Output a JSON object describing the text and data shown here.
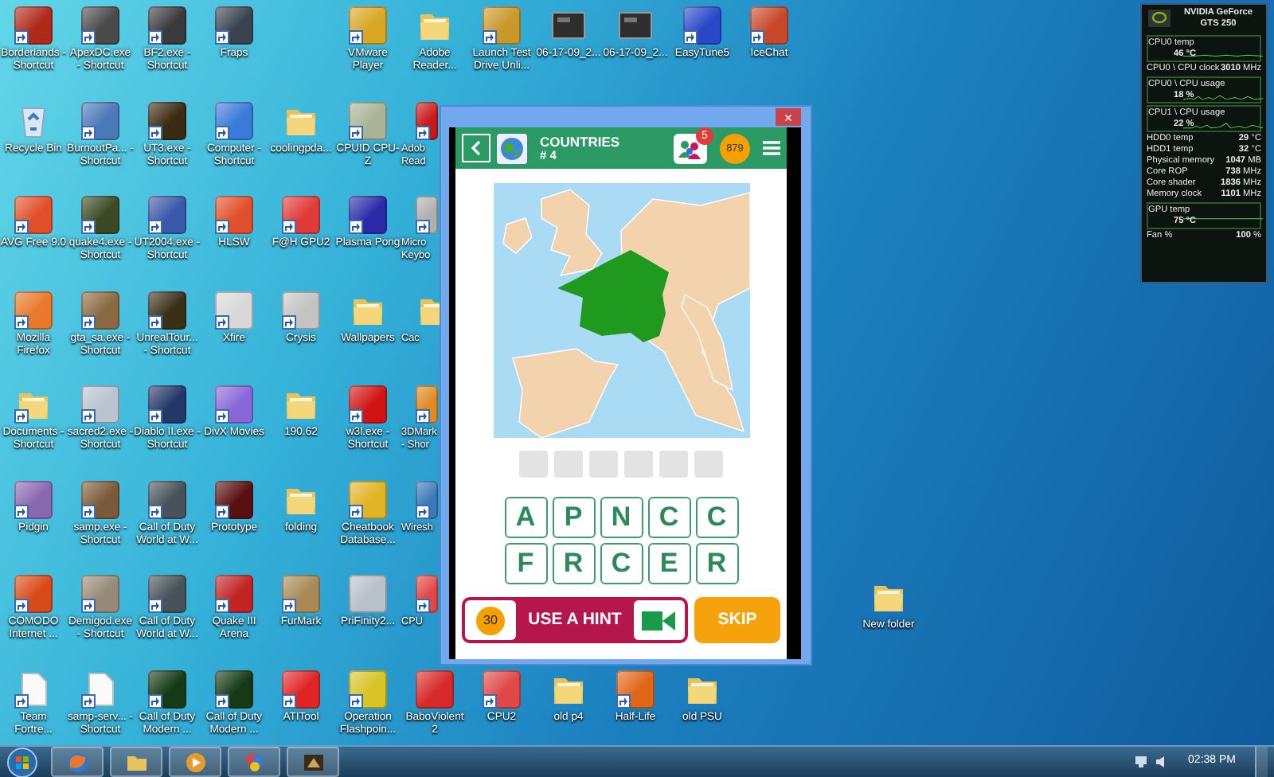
{
  "desktop": {
    "columns": [
      {
        "icons": [
          {
            "label": "Borderlands - Shortcut",
            "kind": "app",
            "color": "#b02a1a",
            "shortcut": true
          },
          {
            "label": "Recycle Bin",
            "kind": "bin",
            "shortcut": false
          },
          {
            "label": "AVG Free 9.0",
            "kind": "app",
            "color": "#e0502a",
            "shortcut": true
          },
          {
            "label": "Mozilla Firefox",
            "kind": "app",
            "color": "#e8782a",
            "shortcut": true
          },
          {
            "label": "Documents - Shortcut",
            "kind": "folder",
            "shortcut": true
          },
          {
            "label": "Pidgin",
            "kind": "app",
            "color": "#8a68b0",
            "shortcut": true
          },
          {
            "label": "COMODO Internet ...",
            "kind": "app",
            "color": "#d84a1a",
            "shortcut": true
          },
          {
            "label": "Team Fortre...",
            "kind": "file",
            "shortcut": true
          }
        ]
      },
      {
        "icons": [
          {
            "label": "ApexDC.exe - Shortcut",
            "kind": "app",
            "color": "#4a4a4a",
            "shortcut": true
          },
          {
            "label": "BurnoutPa... - Shortcut",
            "kind": "app",
            "color": "#4a78b8",
            "shortcut": true
          },
          {
            "label": "quake4.exe - Shortcut",
            "kind": "app",
            "color": "#3a4a22",
            "shortcut": true
          },
          {
            "label": "gta_sa.exe - Shortcut",
            "kind": "app",
            "color": "#8a6a40",
            "shortcut": true
          },
          {
            "label": "sacred2.exe - Shortcut",
            "kind": "app",
            "color": "#b8c4d0",
            "shortcut": true
          },
          {
            "label": "samp.exe - Shortcut",
            "kind": "app",
            "color": "#7a5a3a",
            "shortcut": true
          },
          {
            "label": "Demigod.exe - Shortcut",
            "kind": "app",
            "color": "#988a78",
            "shortcut": true
          },
          {
            "label": "samp-serv... - Shortcut",
            "kind": "file",
            "shortcut": true
          }
        ]
      },
      {
        "icons": [
          {
            "label": "BF2.exe - Shortcut",
            "kind": "app",
            "color": "#3a3a3a",
            "shortcut": true
          },
          {
            "label": "UT3.exe - Shortcut",
            "kind": "app",
            "color": "#3a2a10",
            "shortcut": true
          },
          {
            "label": "UT2004.exe - Shortcut",
            "kind": "app",
            "color": "#3a58a8",
            "shortcut": true
          },
          {
            "label": "UnrealTour... - Shortcut",
            "kind": "app",
            "color": "#3a3018",
            "shortcut": true
          },
          {
            "label": "Diablo II.exe - Shortcut",
            "kind": "app",
            "color": "#243868",
            "shortcut": true
          },
          {
            "label": "Call of Duty World at W...",
            "kind": "app",
            "color": "#48525a",
            "shortcut": true
          },
          {
            "label": "Call of Duty World at W...",
            "kind": "app",
            "color": "#48525a",
            "shortcut": true
          },
          {
            "label": "Call of Duty Modern ...",
            "kind": "app",
            "color": "#163a16",
            "shortcut": true
          }
        ]
      },
      {
        "icons": [
          {
            "label": "Fraps",
            "kind": "app",
            "color": "#3a4450",
            "shortcut": true
          },
          {
            "label": "Computer - Shortcut",
            "kind": "app",
            "color": "#3a7ad8",
            "shortcut": true
          },
          {
            "label": "HLSW",
            "kind": "app",
            "color": "#e0502a",
            "shortcut": true
          },
          {
            "label": "Xfire",
            "kind": "app",
            "color": "#d8d8d8",
            "shortcut": true
          },
          {
            "label": "DivX Movies",
            "kind": "app",
            "color": "#8868d8",
            "shortcut": true
          },
          {
            "label": "Prototype",
            "kind": "app",
            "color": "#5a1010",
            "shortcut": true
          },
          {
            "label": "Quake III Arena",
            "kind": "app",
            "color": "#c02424",
            "shortcut": true
          },
          {
            "label": "Call of Duty Modern ...",
            "kind": "app",
            "color": "#163a16",
            "shortcut": true
          }
        ]
      },
      {
        "icons": [
          {
            "label": "coolingpda...",
            "kind": "folder",
            "shortcut": false
          },
          {
            "label": "F@H GPU2",
            "kind": "app",
            "color": "#e03a3a",
            "shortcut": true
          },
          {
            "label": "Crysis",
            "kind": "app",
            "color": "#c4c4c4",
            "shortcut": true
          },
          {
            "label": "190.62",
            "kind": "folder",
            "shortcut": false
          },
          {
            "label": "folding",
            "kind": "folder",
            "shortcut": false
          },
          {
            "label": "FurMark",
            "kind": "app",
            "color": "#a88a58",
            "shortcut": true
          },
          {
            "label": "ATITool",
            "kind": "app",
            "color": "#e02424",
            "shortcut": true
          }
        ]
      },
      {
        "icons": [
          {
            "label": "VMware Player",
            "kind": "app",
            "color": "#d8a824",
            "shortcut": true
          },
          {
            "label": "CPUID CPU-Z",
            "kind": "app",
            "color": "#a8b498",
            "shortcut": true
          },
          {
            "label": "Plasma Pong",
            "kind": "app",
            "color": "#2a2aa8",
            "shortcut": true
          },
          {
            "label": "Wallpapers",
            "kind": "folder",
            "shortcut": false
          },
          {
            "label": "w3l.exe - Shortcut",
            "kind": "app",
            "color": "#d01414",
            "shortcut": true
          },
          {
            "label": "Cheatbook Database...",
            "kind": "app",
            "color": "#e0b424",
            "shortcut": true
          },
          {
            "label": "PriFinity2...",
            "kind": "app",
            "color": "#b8c0c8",
            "shortcut": false
          },
          {
            "label": "Operation Flashpoin...",
            "kind": "app",
            "color": "#d8c424",
            "shortcut": true
          }
        ]
      },
      {
        "icons": [
          {
            "label": "Adobe Reader...",
            "kind": "folder",
            "shortcut": false
          },
          {
            "label": "Adob Read",
            "kind": "app",
            "color": "#c81818",
            "shortcut": true,
            "cut": true
          },
          {
            "label": "Micro Keybo",
            "kind": "app",
            "color": "#b0b0b0",
            "shortcut": true,
            "cut": true
          },
          {
            "label": "Cac",
            "kind": "folder",
            "shortcut": false,
            "cut": true
          },
          {
            "label": "3DMark - Shor",
            "kind": "app",
            "color": "#e08a24",
            "shortcut": true,
            "cut": true
          },
          {
            "label": "Wiresh",
            "kind": "app",
            "color": "#3a7ab8",
            "shortcut": true,
            "cut": true
          },
          {
            "label": "CPU",
            "kind": "app",
            "color": "#e04848",
            "shortcut": true,
            "cut": true
          },
          {
            "label": "BaboViolent 2",
            "kind": "app",
            "color": "#d82a2a",
            "shortcut": false
          }
        ]
      },
      {
        "icons": [
          {
            "label": "Launch Test Drive Unli...",
            "kind": "app",
            "color": "#c8982a",
            "shortcut": true
          },
          {
            "label": "CPU2",
            "kind": "app",
            "color": "#e04848",
            "shortcut": true
          }
        ]
      },
      {
        "icons": [
          {
            "label": "06-17-09_2...",
            "kind": "image",
            "shortcut": false
          },
          {
            "label": "old p4",
            "kind": "folder",
            "shortcut": false
          }
        ]
      },
      {
        "icons": [
          {
            "label": "06-17-09_2...",
            "kind": "image",
            "shortcut": false
          },
          {
            "label": "Half-Life",
            "kind": "app",
            "color": "#e0661a",
            "shortcut": true
          }
        ]
      },
      {
        "icons": [
          {
            "label": "EasyTune5",
            "kind": "app",
            "color": "#2a48c8",
            "shortcut": true
          },
          {
            "label": "old PSU",
            "kind": "folder",
            "shortcut": false
          }
        ]
      },
      {
        "icons": [
          {
            "label": "IceChat",
            "kind": "app",
            "color": "#c8482a",
            "shortcut": true
          }
        ]
      }
    ],
    "loose_icons": [
      {
        "label": "New folder",
        "kind": "folder",
        "shortcut": false
      }
    ]
  },
  "game_window": {
    "close": "×",
    "category": "COUNTRIES",
    "level": "# 4",
    "badge": "5",
    "coins": "879",
    "answer_slots": [
      {
        "filled": false
      },
      {
        "filled": false
      },
      {
        "filled": false
      },
      {
        "filled": false
      },
      {
        "filled": false
      },
      {
        "filled": false
      }
    ],
    "letter_rows": [
      [
        "A",
        "P",
        "N",
        "C",
        "C"
      ],
      [
        "F",
        "R",
        "C",
        "E",
        "R"
      ]
    ],
    "hint_button": {
      "cost": "30",
      "label": "USE A HINT"
    },
    "skip_button": {
      "label": "SKIP"
    }
  },
  "gpu_gadget": {
    "title": "NVIDIA GeForce GTS 250",
    "rows": [
      {
        "kind": "graph",
        "label": "CPU0 temp",
        "value": "46 °C"
      },
      {
        "kind": "stat",
        "label": "CPU0 \\ CPU clock",
        "value": "3010",
        "unit": "MHz"
      },
      {
        "kind": "graph",
        "label": "CPU0 \\ CPU usage",
        "value": "18 %"
      },
      {
        "kind": "graph",
        "label": "CPU1 \\ CPU usage",
        "value": "22 %"
      },
      {
        "kind": "stat",
        "label": "HDD0 temp",
        "value": "29",
        "unit": "°C"
      },
      {
        "kind": "stat",
        "label": "HDD1 temp",
        "value": "32",
        "unit": "°C"
      },
      {
        "kind": "stat",
        "label": "Physical memory",
        "value": "1047",
        "unit": "MB"
      },
      {
        "kind": "stat",
        "label": "Core ROP",
        "value": "738",
        "unit": "MHz"
      },
      {
        "kind": "stat",
        "label": "Core shader",
        "value": "1836",
        "unit": "MHz"
      },
      {
        "kind": "stat",
        "label": "Memory clock",
        "value": "1101",
        "unit": "MHz"
      },
      {
        "kind": "graph",
        "label": "GPU temp",
        "value": "75 °C"
      },
      {
        "kind": "stat",
        "label": "Fan %",
        "value": "100",
        "unit": "%"
      }
    ]
  },
  "taskbar": {
    "clock": "02:38 PM"
  }
}
